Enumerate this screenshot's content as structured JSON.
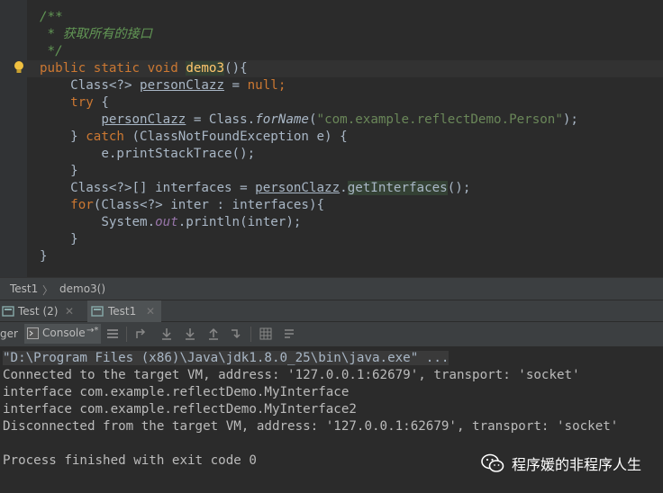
{
  "editor": {
    "comment_open": "/**",
    "comment_doc": " * 获取所有的接口",
    "comment_close": " */",
    "sig_kw1": "public",
    "sig_kw2": "static",
    "sig_kw3": "void",
    "sig_name": "demo3",
    "sig_rest": "(){",
    "l5_a": "    Class<?> ",
    "l5_var": "personClazz",
    "l5_eq": " = ",
    "l5_null": "null",
    "l5_end": ";",
    "l6_try": "try",
    "l6_brace": " {",
    "l7_indent": "        ",
    "l7_var": "personClazz",
    "l7_b": " = Class.",
    "l7_fn": "forName",
    "l7_p1": "(",
    "l7_str": "\"com.example.reflectDemo.Person\"",
    "l7_p2": ");",
    "l8_a": "    } ",
    "l8_catch": "catch",
    "l8_b": " (ClassNotFoundException e) {",
    "l9": "        e.printStackTrace();",
    "l10": "    }",
    "l11_a": "    Class<?>[] interfaces = ",
    "l11_var": "personClazz",
    "l11_dot": ".",
    "l11_m": "getInterfaces",
    "l11_end": "();",
    "l12_for": "for",
    "l12_b": "(Class<?> inter : interfaces){",
    "l13_a": "        System.",
    "l13_out": "out",
    "l13_b": ".println(inter);",
    "l14": "    }",
    "l15": "}"
  },
  "breadcrumb": {
    "class": "Test1",
    "sep": "〉",
    "method": "demo3()"
  },
  "runtabs": [
    {
      "label": "Test (2)"
    },
    {
      "label": "Test1"
    }
  ],
  "toolbar": {
    "debugger_label": "ger",
    "console_label": "Console",
    "console_suffix": "→*"
  },
  "console": {
    "cmd": "\"D:\\Program Files (x86)\\Java\\jdk1.8.0_25\\bin\\java.exe\" ...",
    "l1": "Connected to the target VM, address: '127.0.0.1:62679', transport: 'socket'",
    "l2": "interface com.example.reflectDemo.MyInterface",
    "l3": "interface com.example.reflectDemo.MyInterface2",
    "l4": "Disconnected from the target VM, address: '127.0.0.1:62679', transport: 'socket'",
    "l5": "Process finished with exit code 0"
  },
  "watermark": {
    "text": "程序媛的非程序人生"
  },
  "colors": {
    "keyword": "#cc7832",
    "comment": "#629755",
    "method": "#ffc66d",
    "string": "#6a8759",
    "field": "#9876aa"
  }
}
